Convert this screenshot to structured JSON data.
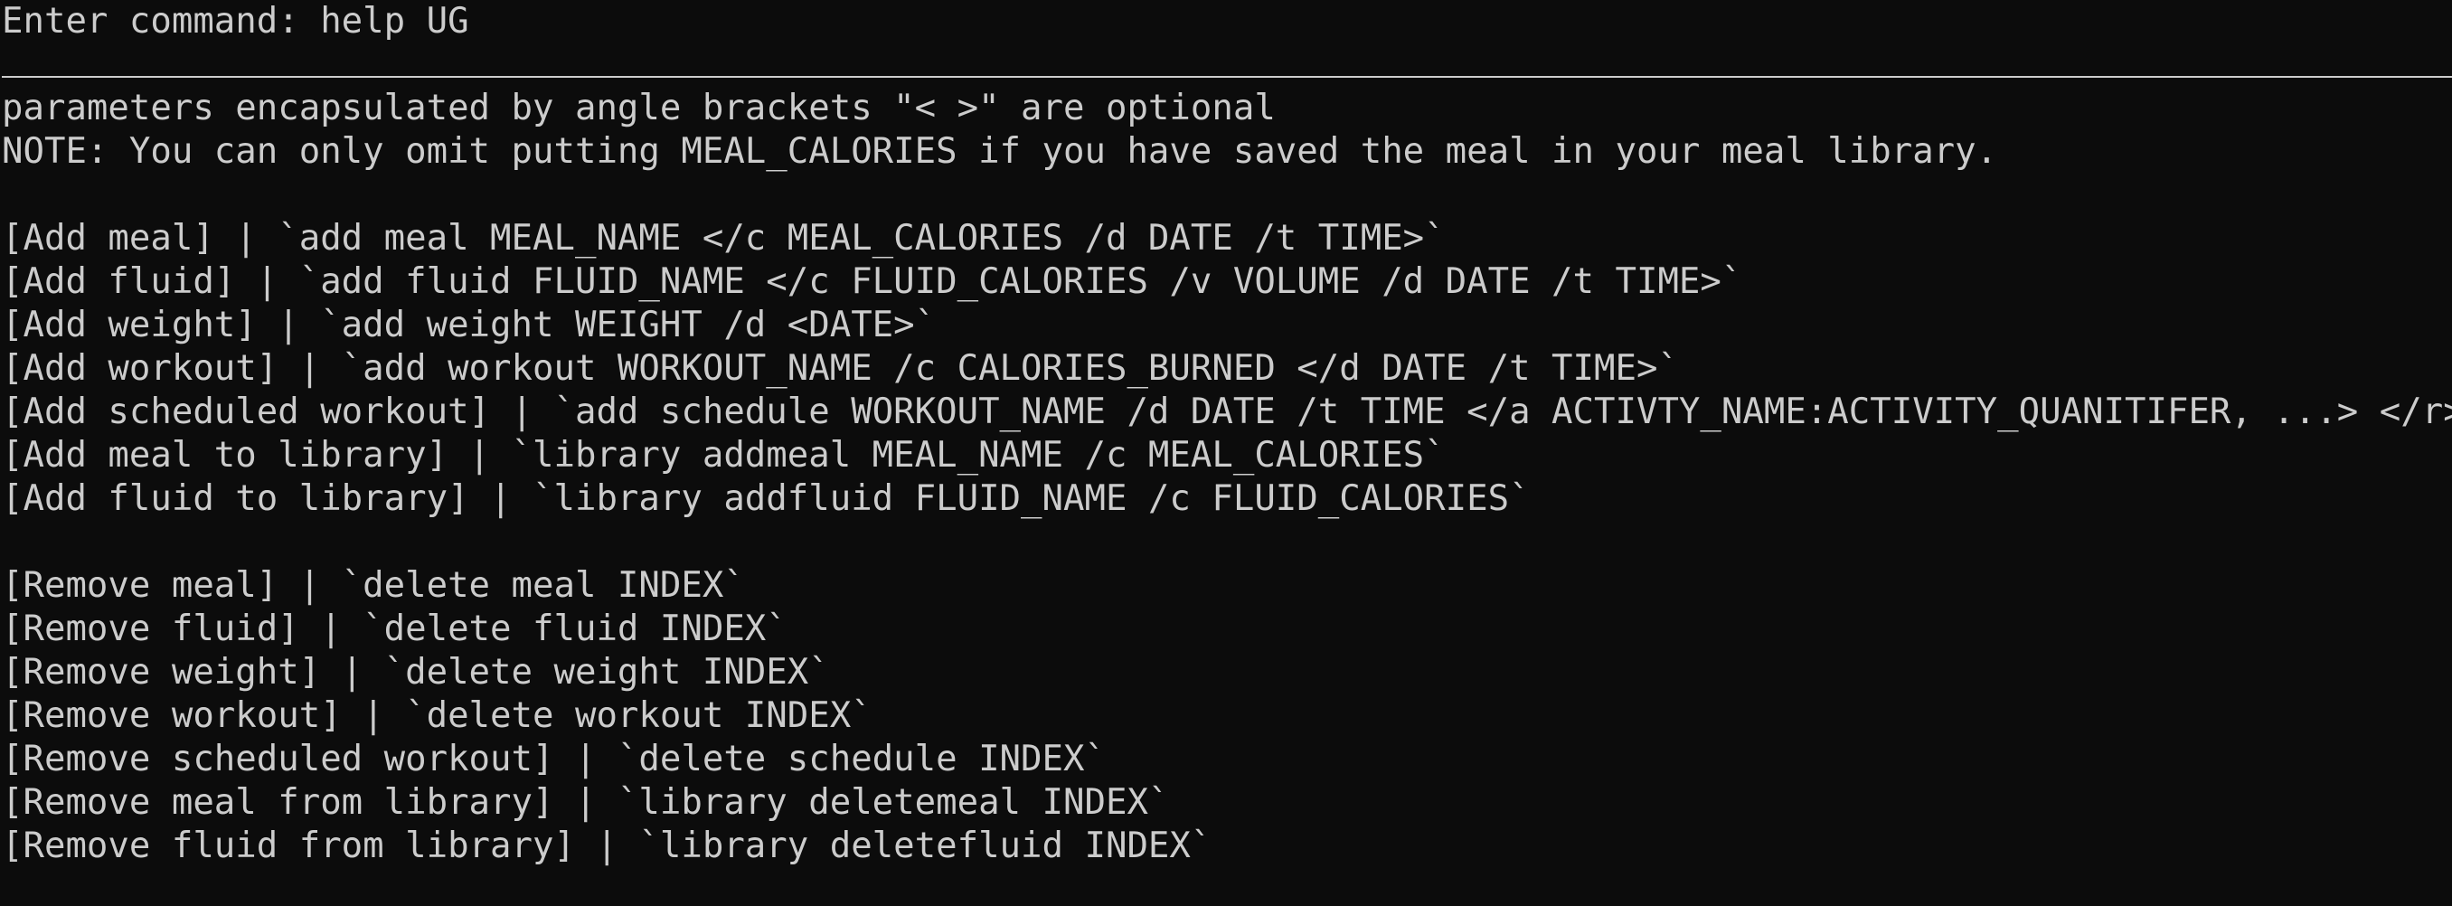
{
  "terminal": {
    "prompt": "Enter command: help UG",
    "intro": [
      "parameters encapsulated by angle brackets \"< >\" are optional",
      "NOTE: You can only omit putting MEAL_CALORIES if you have saved the meal in your meal library."
    ],
    "add_commands": [
      "[Add meal] | `add meal MEAL_NAME </c MEAL_CALORIES /d DATE /t TIME>`",
      "[Add fluid] | `add fluid FLUID_NAME </c FLUID_CALORIES /v VOLUME /d DATE /t TIME>`",
      "[Add weight] | `add weight WEIGHT /d <DATE>`",
      "[Add workout] | `add workout WORKOUT_NAME /c CALORIES_BURNED </d DATE /t TIME>`",
      "[Add scheduled workout] | `add schedule WORKOUT_NAME /d DATE /t TIME </a ACTIVTY_NAME:ACTIVITY_QUANITIFER, ...> </r>`",
      "[Add meal to library] | `library addmeal MEAL_NAME /c MEAL_CALORIES`",
      "[Add fluid to library] | `library addfluid FLUID_NAME /c FLUID_CALORIES`"
    ],
    "remove_commands": [
      "[Remove meal] | `delete meal INDEX`",
      "[Remove fluid] | `delete fluid INDEX`",
      "[Remove weight] | `delete weight INDEX`",
      "[Remove workout] | `delete workout INDEX`",
      "[Remove scheduled workout] | `delete schedule INDEX`",
      "[Remove meal from library] | `library deletemeal INDEX`",
      "[Remove fluid from library] | `library deletefluid INDEX`"
    ],
    "colors": {
      "background": "#0c0c0c",
      "foreground": "#cccccc"
    }
  }
}
